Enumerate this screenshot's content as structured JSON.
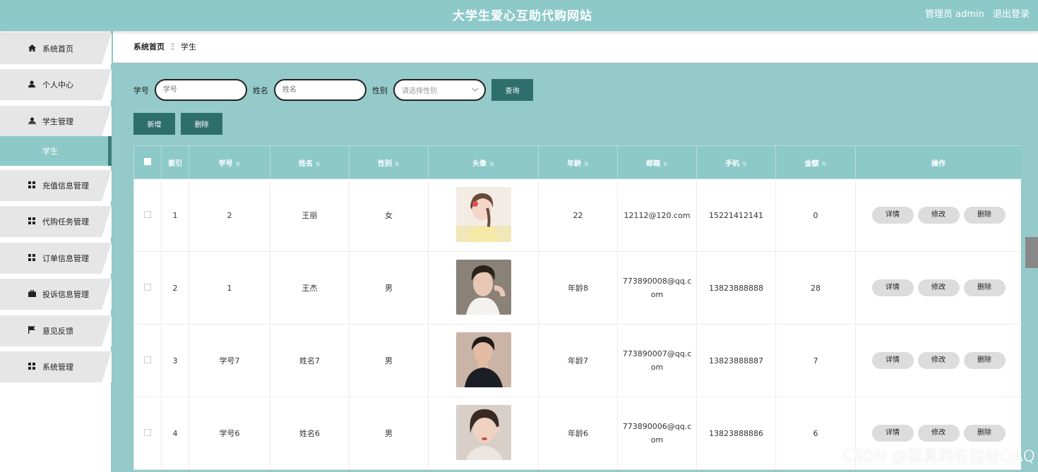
{
  "header": {
    "title": "大学生爱心互助代购网站",
    "user_label": "管理员 admin",
    "logout_label": "退出登录"
  },
  "sidebar": {
    "items": [
      {
        "label": "系统首页",
        "icon": "home-icon"
      },
      {
        "label": "个人中心",
        "icon": "user-icon"
      },
      {
        "label": "学生管理",
        "icon": "users-icon"
      },
      {
        "label": "学生",
        "icon": ""
      },
      {
        "label": "充值信息管理",
        "icon": "grid-icon"
      },
      {
        "label": "代购任务管理",
        "icon": "grid-icon"
      },
      {
        "label": "订单信息管理",
        "icon": "grid-icon"
      },
      {
        "label": "投诉信息管理",
        "icon": "briefcase-icon"
      },
      {
        "label": "意见反馈",
        "icon": "flag-icon"
      },
      {
        "label": "系统管理",
        "icon": "grid-icon"
      }
    ]
  },
  "breadcrumb": {
    "home": "系统首页",
    "separator": "Ξ",
    "current": "学生"
  },
  "search": {
    "id_label": "学号",
    "id_placeholder": "学号",
    "name_label": "姓名",
    "name_placeholder": "姓名",
    "gender_label": "性别",
    "gender_placeholder": "请选择性别",
    "query_label": "查询"
  },
  "actions": {
    "add_label": "新增",
    "delete_label": "删除"
  },
  "table": {
    "headers": [
      "索引",
      "学号",
      "姓名",
      "性别",
      "头像",
      "年龄",
      "邮箱",
      "手机",
      "金额",
      "操作"
    ],
    "rows": [
      {
        "index": "1",
        "student_id": "2",
        "name": "王丽",
        "gender": "女",
        "age": "22",
        "email": "12112@120.com",
        "phone": "15221412141",
        "amount": "0"
      },
      {
        "index": "2",
        "student_id": "1",
        "name": "王杰",
        "gender": "男",
        "age": "年龄8",
        "email": "773890008@qq.com",
        "phone": "13823888888",
        "amount": "28"
      },
      {
        "index": "3",
        "student_id": "学号7",
        "name": "姓名7",
        "gender": "男",
        "age": "年龄7",
        "email": "773890007@qq.com",
        "phone": "13823888887",
        "amount": "7"
      },
      {
        "index": "4",
        "student_id": "学号6",
        "name": "姓名6",
        "gender": "男",
        "age": "年龄6",
        "email": "773890006@qq.com",
        "phone": "13823888886",
        "amount": "6"
      }
    ],
    "op_detail": "详情",
    "op_edit": "修改",
    "op_delete": "删除"
  },
  "colors": {
    "primary": "#8ec9c9",
    "dark_button": "#2e6e6c",
    "content_bg": "#94caca"
  },
  "watermark": "CSDN @我真的在拉扯QAQ"
}
